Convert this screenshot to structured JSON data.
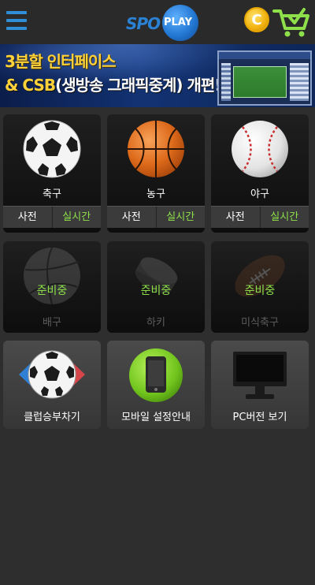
{
  "header": {
    "logo_left": "SPO",
    "logo_right": "PLAY",
    "coin_symbol": "C"
  },
  "banner": {
    "line1": "3분할 인터페이스",
    "line2_prefix": "& CSB",
    "line2_middle": "(생방송 그래픽중계)",
    "line2_suffix": " 개편!"
  },
  "sports": [
    {
      "name": "축구",
      "pre_label": "사전",
      "live_label": "실시간",
      "icon": "soccer-ball-icon"
    },
    {
      "name": "농구",
      "pre_label": "사전",
      "live_label": "실시간",
      "icon": "basketball-icon"
    },
    {
      "name": "야구",
      "pre_label": "사전",
      "live_label": "실시간",
      "icon": "baseball-icon"
    }
  ],
  "coming_soon": [
    {
      "name": "배구",
      "status": "준비중",
      "icon": "volleyball-icon"
    },
    {
      "name": "하키",
      "status": "준비중",
      "icon": "hockey-puck-icon"
    },
    {
      "name": "미식축구",
      "status": "준비중",
      "icon": "football-icon"
    }
  ],
  "shortcuts": [
    {
      "name": "클럽승부차기",
      "icon": "club-penalty-icon"
    },
    {
      "name": "모바일 설정안내",
      "icon": "mobile-phone-icon"
    },
    {
      "name": "PC버전 보기",
      "icon": "monitor-icon"
    }
  ],
  "colors": {
    "accent_green": "#8ee04a",
    "brand_blue": "#2f8fd6",
    "coin_gold": "#f2b20f",
    "background": "#2e2e2e"
  }
}
